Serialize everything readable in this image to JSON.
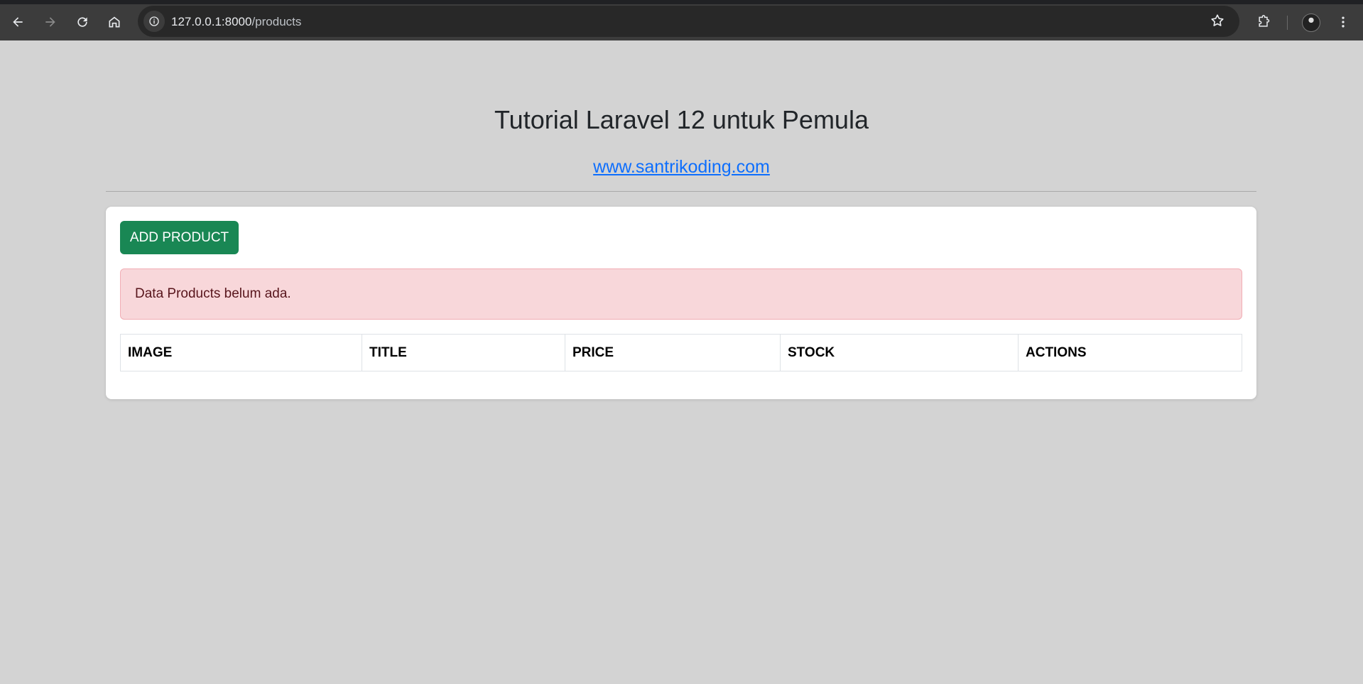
{
  "browser": {
    "url_host": "127.0.0.1:8000",
    "url_path": "/products",
    "icons": [
      "back-icon",
      "forward-icon",
      "reload-icon",
      "home-icon",
      "site-info-icon",
      "bookmark-star-icon",
      "extensions-icon",
      "profile-avatar",
      "more-menu-icon"
    ]
  },
  "page": {
    "title": "Tutorial Laravel 12 untuk Pemula",
    "link_text": "www.santrikoding.com"
  },
  "card": {
    "add_button_label": "ADD PRODUCT",
    "alert_text": "Data Products belum ada.",
    "table_headers": [
      "IMAGE",
      "TITLE",
      "PRICE",
      "STOCK",
      "ACTIONS"
    ]
  },
  "colors": {
    "background": "#d3d3d3",
    "button_green": "#198754",
    "alert_bg": "#f8d7da",
    "link_blue": "#0d6efd"
  }
}
